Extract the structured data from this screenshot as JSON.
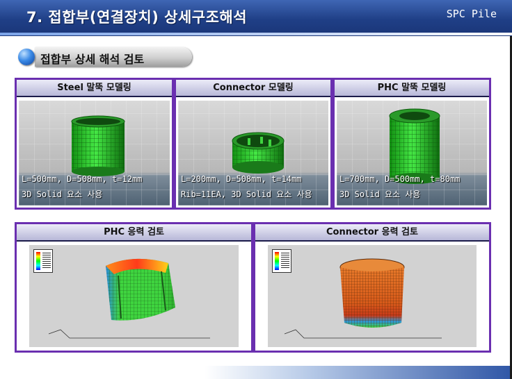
{
  "header": {
    "title": "7.  접합부(연결장치) 상세구조해석",
    "tag": "SPC  Pile"
  },
  "section": {
    "title": "접합부 상세 해석 검토"
  },
  "modeling_panels": [
    {
      "title": "Steel 말뚝 모델링",
      "caption_line1": "L=500mm, D=508mm, t=12mm",
      "caption_line2": "3D Solid 요소 사용"
    },
    {
      "title": "Connector 모델링",
      "caption_line1": "L=200mm, D=508mm, t=14mm",
      "caption_line2": "Rib=11EA, 3D Solid 요소 사용"
    },
    {
      "title": "PHC 말뚝 모델링",
      "caption_line1": "L=700mm, D=500mm, t=80mm",
      "caption_line2": "3D Solid 요소 사용"
    }
  ],
  "stress_panels": [
    {
      "title": "PHC 응력 검토"
    },
    {
      "title": "Connector 응력 검토"
    }
  ],
  "colors": {
    "panel_border": "#6a2fb0",
    "header_blue": "#1f3f86",
    "mesh_green": "#2bc52b"
  }
}
